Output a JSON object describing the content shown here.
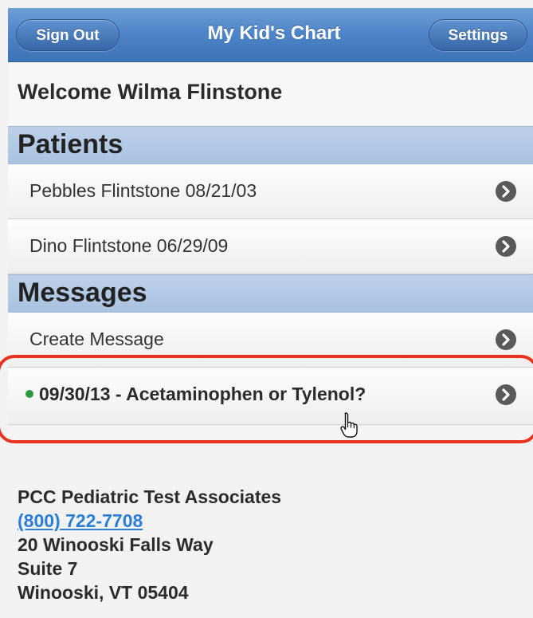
{
  "header": {
    "sign_out_label": "Sign Out",
    "title": "My Kid's Chart",
    "settings_label": "Settings",
    "bar_color": "#4f86c9"
  },
  "welcome": {
    "text": "Welcome Wilma Flinstone"
  },
  "patients": {
    "heading": "Patients",
    "items": [
      {
        "label": "Pebbles Flintstone 08/21/03"
      },
      {
        "label": "Dino Flintstone 06/29/09"
      }
    ]
  },
  "messages": {
    "heading": "Messages",
    "create_label": "Create Message",
    "items": [
      {
        "label": "09/30/13 - Acetaminophen or Tylenol?",
        "unread": true,
        "status_color": "#2b9a3f"
      }
    ]
  },
  "footer": {
    "practice_name": "PCC Pediatric Test Associates",
    "phone": "(800) 722-7708",
    "address_line1": "20 Winooski Falls Way",
    "address_line2": "Suite 7",
    "city_state_zip": "Winooski, VT 05404"
  },
  "icons": {
    "chevron": "chevron-right-icon",
    "cursor": "hand-pointer-icon"
  },
  "highlight_color": "#e8321f"
}
